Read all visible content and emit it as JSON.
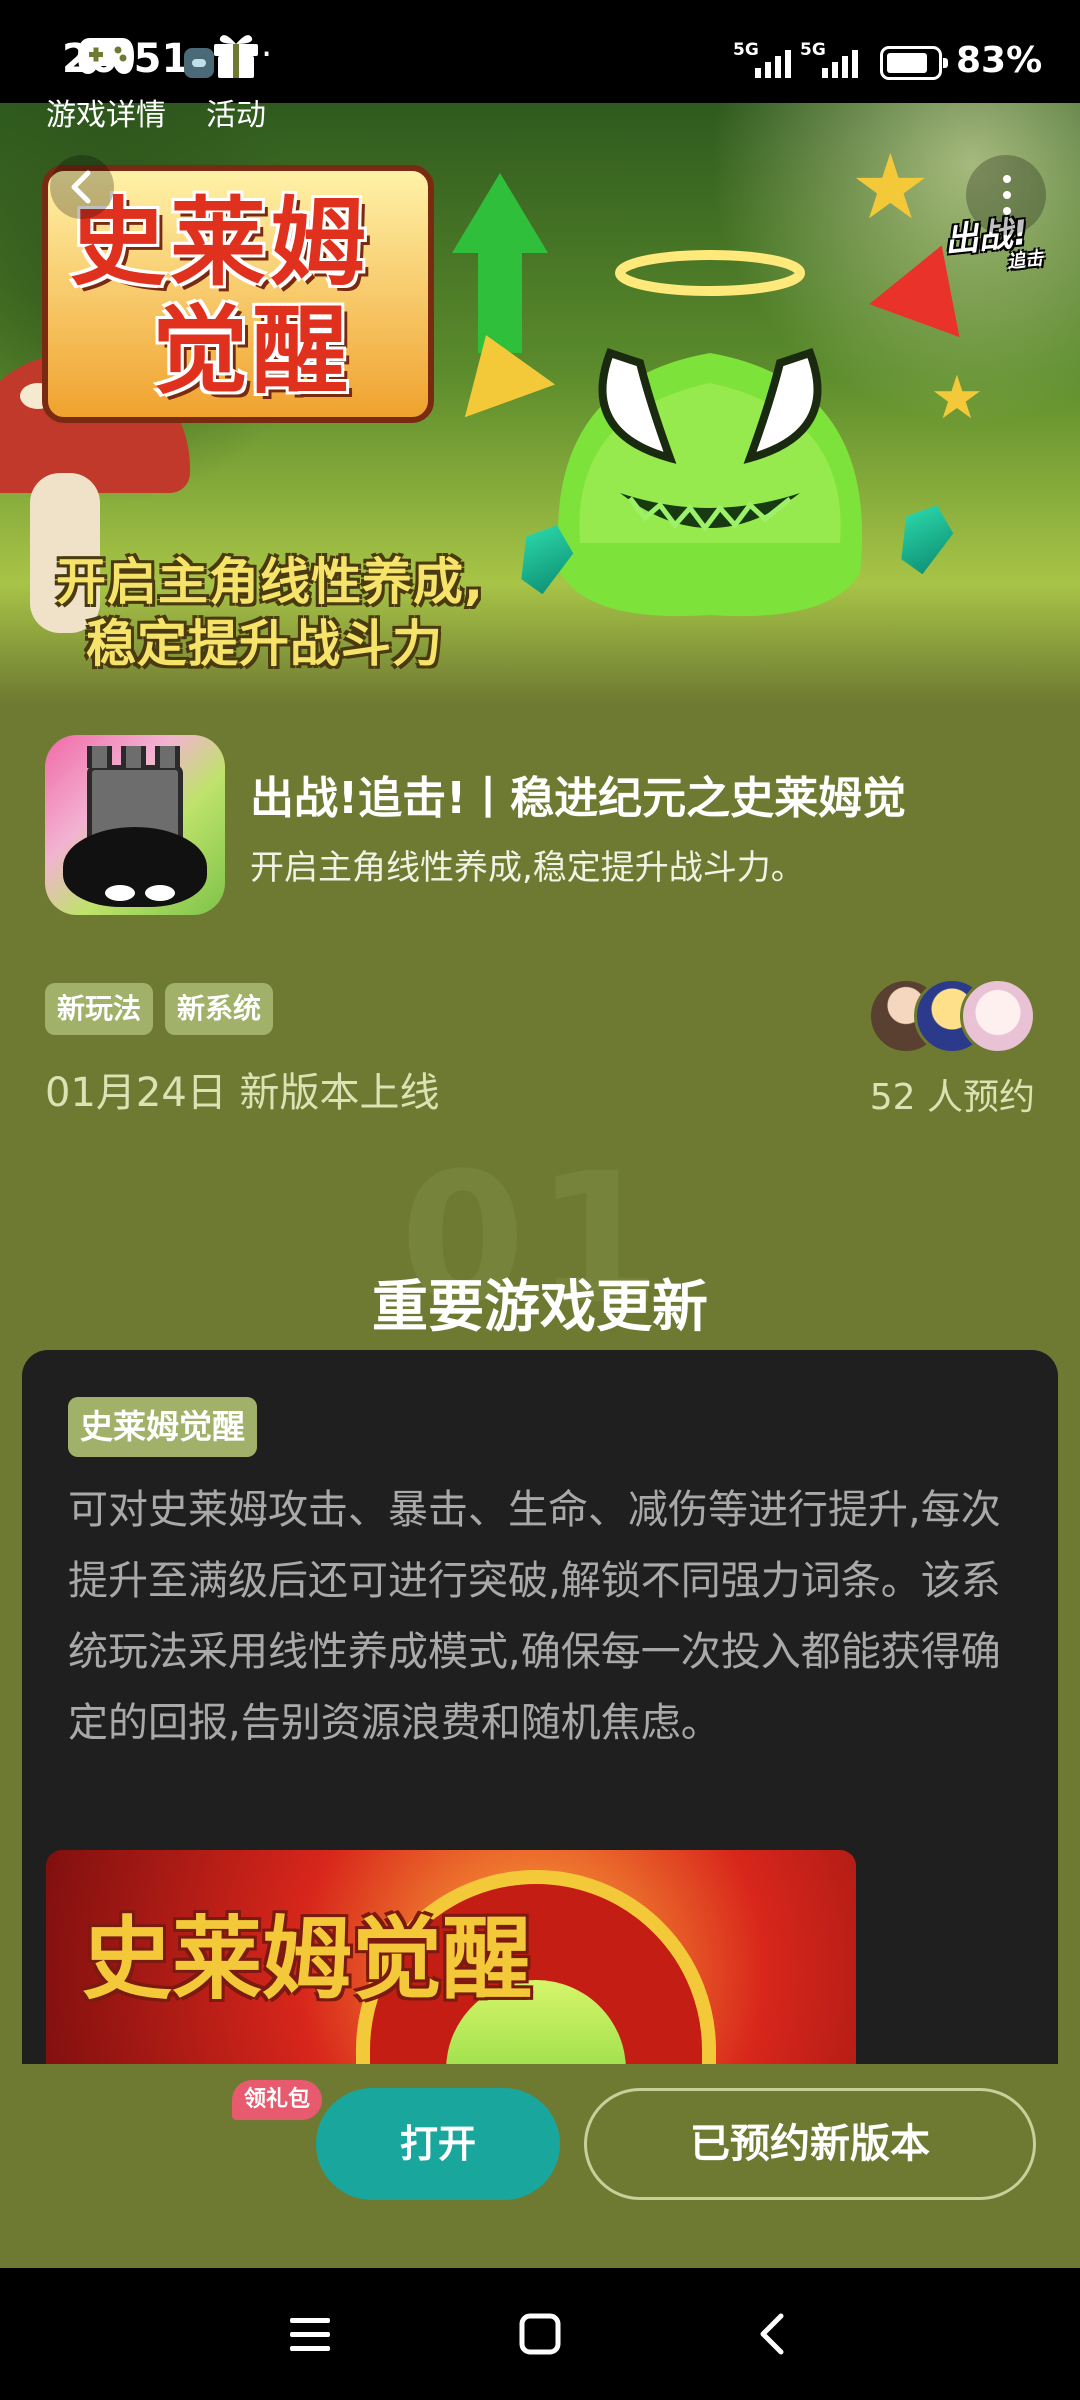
{
  "status_bar": {
    "time": "20:51",
    "more": "···",
    "signal1": "5G",
    "signal2": "5G",
    "battery": "83%",
    "battery_level": 0.83
  },
  "hero": {
    "title_line1": "史莱姆",
    "title_line2": "觉醒",
    "subtitle_line1": "开启主角线性养成,",
    "subtitle_line2": "稳定提升战斗力",
    "logo_main": "出战!",
    "logo_sub": "追击"
  },
  "app": {
    "name": "出战!追击!丨稳进纪元之史莱姆觉",
    "description": "开启主角线性养成,稳定提升战斗力。"
  },
  "tags": [
    "新玩法",
    "新系统"
  ],
  "release_text": "01月24日 新版本上线",
  "reserve_count": "52 人预约",
  "section": {
    "bg_number": "01",
    "title": "重要游戏更新"
  },
  "card": {
    "chip": "史莱姆觉醒",
    "text": "可对史莱姆攻击、暴击、生命、减伤等进行提升,每次提升至满级后还可进行突破,解锁不同强力词条。该系统玩法采用线性养成模式,确保每一次投入都能获得确定的回报,告别资源浪费和随机焦虑。",
    "image_title": "史莱姆觉醒"
  },
  "actions": {
    "detail_label": "游戏详情",
    "activity_label": "活动",
    "gift_badge": "领礼包",
    "open_label": "打开",
    "reserved_label": "已预约新版本"
  },
  "colors": {
    "page_bg": "#6e7a32",
    "tag_bg": "#a2b169",
    "open_btn": "#19a69c",
    "badge": "#e85a6e",
    "card_bg": "#1f1f1f"
  }
}
